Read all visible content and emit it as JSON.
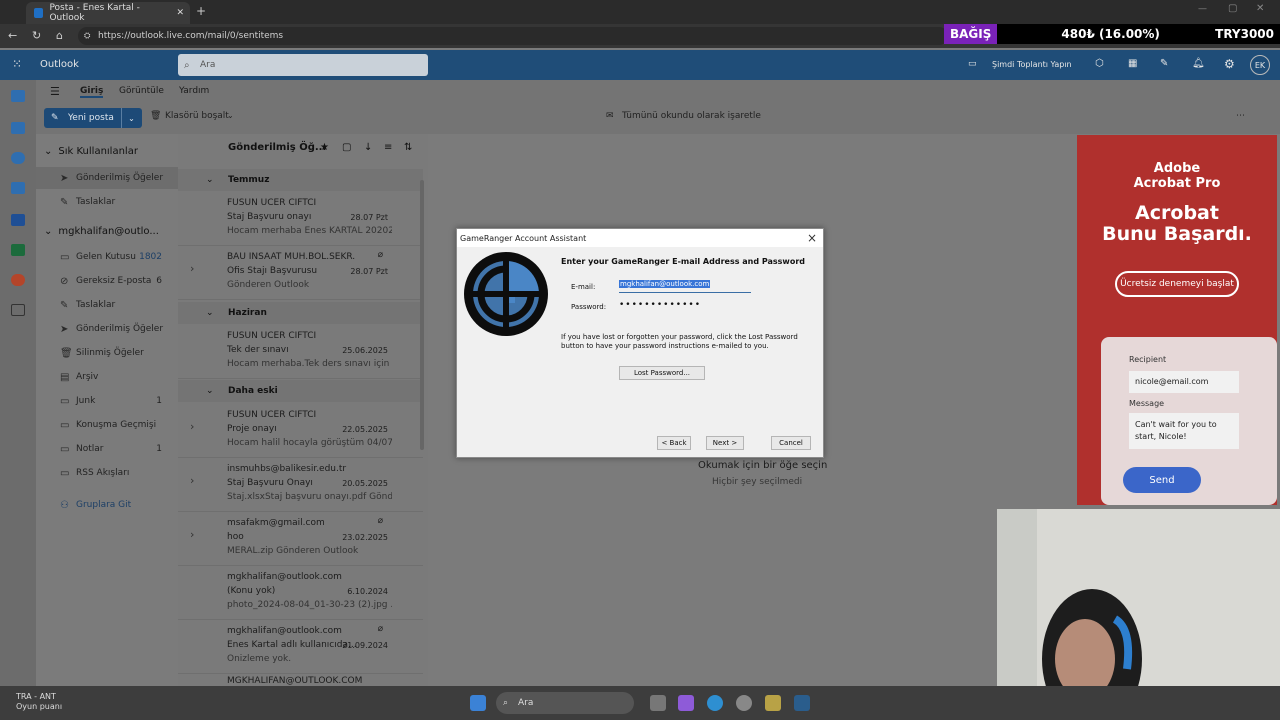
{
  "browser": {
    "tab_title": "Posta - Enes Kartal - Outlook",
    "url": "https://outlook.live.com/mail/0/sentitems"
  },
  "donation": {
    "label": "BAĞIŞ",
    "amount": "480₺ (16.00%)",
    "goal": "TRY3000"
  },
  "outlook": {
    "app_name": "Outlook",
    "search_placeholder": "Ara",
    "meet_now": "Şimdi Toplantı Yapın",
    "avatar": "EK"
  },
  "ribbon": {
    "tabs": [
      "Giriş",
      "Görüntüle",
      "Yardım"
    ],
    "new_mail": "Yeni posta",
    "empty_folder": "Klasörü boşalt",
    "mark_all_read": "Tümünü okundu olarak işaretle"
  },
  "folders": {
    "favorites_header": "Sık Kullanılanlar",
    "favorites": [
      {
        "label": "Gönderilmiş Öğeler",
        "count": ""
      },
      {
        "label": "Taslaklar",
        "count": ""
      }
    ],
    "account_header": "mgkhalifan@outlo...",
    "account_items": [
      {
        "label": "Gelen Kutusu",
        "count": "1802"
      },
      {
        "label": "Gereksiz E-posta",
        "count": "6"
      },
      {
        "label": "Taslaklar",
        "count": ""
      },
      {
        "label": "Gönderilmiş Öğeler",
        "count": ""
      },
      {
        "label": "Silinmiş Öğeler",
        "count": ""
      },
      {
        "label": "Arşiv",
        "count": ""
      },
      {
        "label": "Junk",
        "count": "1"
      },
      {
        "label": "Konuşma Geçmişi",
        "count": ""
      },
      {
        "label": "Notlar",
        "count": "1"
      },
      {
        "label": "RSS Akışları",
        "count": ""
      }
    ],
    "groups_link": "Gruplara Git"
  },
  "message_list": {
    "title": "Gönderilmiş Öğ...",
    "groups": [
      "Temmuz",
      "Haziran",
      "Daha eski"
    ],
    "messages": [
      {
        "from": "FUSUN UCER CIFTCI",
        "subject": "Staj Başvuru onayı",
        "date": "28.07 Pzt",
        "preview": "Hocam merhaba Enes KARTAL 20202..."
      },
      {
        "from": "BAU INSAAT MUH.BOL.SEKR.",
        "subject": "Ofis Stajı Başvurusu",
        "date": "28.07 Pzt",
        "preview": "Gönderen Outlook"
      },
      {
        "from": "FUSUN UCER CIFTCI",
        "subject": "Tek der sınavı",
        "date": "25.06.2025",
        "preview": "Hocam merhaba.Tek ders sınavı için d..."
      },
      {
        "from": "FUSUN UCER CIFTCI",
        "subject": "Proje onayı",
        "date": "22.05.2025",
        "preview": "Hocam halil hocayla görüştüm 04/07/..."
      },
      {
        "from": "insmuhbs@balikesir.edu.tr",
        "subject": "Staj Başvuru Onayı",
        "date": "20.05.2025",
        "preview": "Staj.xlsxStaj başvuru onayı.pdf Gönde..."
      },
      {
        "from": "msafakm@gmail.com",
        "subject": "hoo",
        "date": "23.02.2025",
        "preview": "MERAL.zip Gönderen Outlook"
      },
      {
        "from": "mgkhalifan@outlook.com",
        "subject": "(Konu yok)",
        "date": "6.10.2024",
        "preview": "photo_2024-08-04_01-30-23 (2).jpg ..."
      },
      {
        "from": "mgkhalifan@outlook.com",
        "subject": "Enes Kartal adlı kullanıcıda...",
        "date": "21.09.2024",
        "preview": "Önizleme yok."
      },
      {
        "from": "MGKHALIFAN@OUTLOOK.COM",
        "subject": "",
        "date": "",
        "preview": ""
      }
    ]
  },
  "reading_pane": {
    "title": "Okumak için bir öğe seçin",
    "subtitle": "Hiçbir şey seçilmedi"
  },
  "dialog": {
    "title": "GameRanger Account Assistant",
    "heading": "Enter your GameRanger E-mail Address and Password",
    "email_label": "E-mail:",
    "email_value": "mgkhalifan@outlook.com",
    "password_label": "Password:",
    "password_value": "•••••••••••••",
    "note": "If you have lost or forgotten your password, click the Lost Password button to have your password instructions e-mailed to you.",
    "lost_password": "Lost Password...",
    "back": "< Back",
    "next": "Next >",
    "cancel": "Cancel"
  },
  "ad": {
    "logo_line1": "Adobe",
    "logo_line2": "Acrobat Pro",
    "headline1": "Acrobat",
    "headline2": "Bunu Başardı.",
    "cta": "Ücretsiz denemeyi başlat",
    "recipient_label": "Recipient",
    "recipient_value": "nicole@email.com",
    "message_label": "Message",
    "message_value": "Can't wait for you to start, Nicole!",
    "send": "Send"
  },
  "taskbar": {
    "weather_title": "TRA - ANT",
    "weather_sub": "Oyun puanı",
    "search": "Ara"
  }
}
